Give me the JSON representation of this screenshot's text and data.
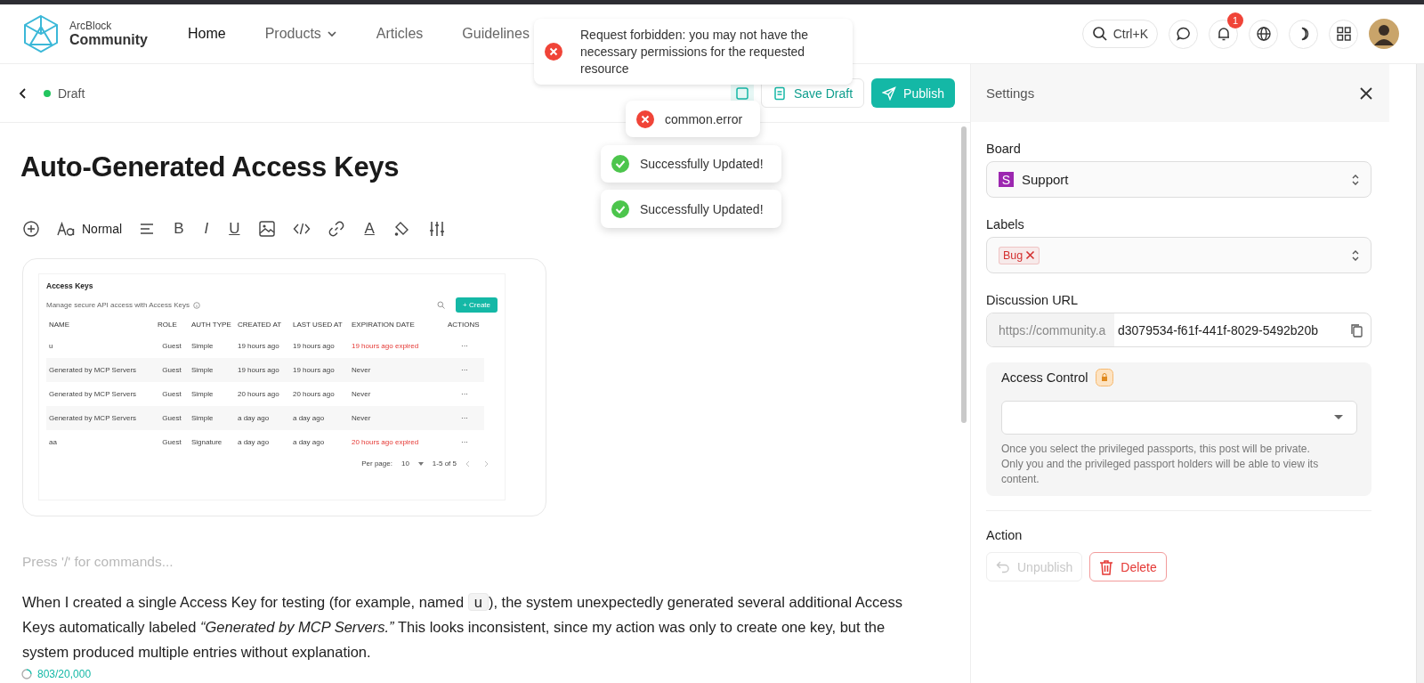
{
  "header": {
    "logo_top": "ArcBlock",
    "logo_bottom": "Community",
    "nav": [
      {
        "label": "Home",
        "selected": true,
        "dropdown": false
      },
      {
        "label": "Products",
        "selected": false,
        "dropdown": true
      },
      {
        "label": "Articles",
        "selected": false,
        "dropdown": false
      },
      {
        "label": "Guidelines",
        "selected": false,
        "dropdown": false
      }
    ],
    "search_shortcut": "Ctrl+K",
    "notification_count": "1"
  },
  "editor_bar": {
    "status": "Draft",
    "save_label": "Save Draft",
    "publish_label": "Publish"
  },
  "post": {
    "title": "Auto-Generated Access Keys",
    "toolbar": [
      {
        "kind": "insert"
      },
      {
        "kind": "heading",
        "label": "Normal"
      },
      {
        "kind": "align"
      },
      {
        "kind": "bold",
        "glyph": "B"
      },
      {
        "kind": "italic",
        "glyph": "I"
      },
      {
        "kind": "underline",
        "glyph": "U"
      },
      {
        "kind": "image"
      },
      {
        "kind": "code"
      },
      {
        "kind": "link"
      },
      {
        "kind": "text-color",
        "glyph": "A"
      },
      {
        "kind": "fill"
      },
      {
        "kind": "sliders"
      }
    ],
    "screenshot": {
      "title": "Access Keys",
      "subtitle": "Manage secure API access with Access Keys",
      "create_label": "+ Create",
      "columns": [
        "NAME",
        "ROLE",
        "AUTH TYPE",
        "CREATED AT",
        "LAST USED AT",
        "EXPIRATION DATE",
        "ACTIONS"
      ],
      "rows": [
        {
          "name": "u",
          "role": "Guest",
          "auth": "Simple",
          "created": "19 hours ago",
          "last_used": "19 hours ago",
          "expiration": "19 hours ago expired",
          "expired": true,
          "actions": "···"
        },
        {
          "name": "Generated by MCP Servers",
          "role": "Guest",
          "auth": "Simple",
          "created": "19 hours ago",
          "last_used": "19 hours ago",
          "expiration": "Never",
          "expired": false,
          "actions": "···"
        },
        {
          "name": "Generated by MCP Servers",
          "role": "Guest",
          "auth": "Simple",
          "created": "20 hours ago",
          "last_used": "20 hours ago",
          "expiration": "Never",
          "expired": false,
          "actions": "···"
        },
        {
          "name": "Generated by MCP Servers",
          "role": "Guest",
          "auth": "Simple",
          "created": "a day ago",
          "last_used": "a day ago",
          "expiration": "Never",
          "expired": false,
          "actions": "···"
        },
        {
          "name": "aa",
          "role": "Guest",
          "auth": "Signature",
          "created": "a day ago",
          "last_used": "a day ago",
          "expiration": "20 hours ago expired",
          "expired": true,
          "actions": "···"
        }
      ],
      "per_page_label": "Per page:",
      "per_page": "10",
      "range": "1-5 of 5"
    },
    "placeholder": "Press '/' for commands...",
    "paragraph": [
      {
        "kind": "text",
        "text": "When I created a single Access Key for testing (for example, named "
      },
      {
        "kind": "code",
        "text": "u"
      },
      {
        "kind": "text",
        "text": "), the system unexpectedly generated several additional Access Keys automatically labeled *“Generated by MCP Servers.”* This looks inconsistent, since my action was only to create one key, but the system produced multiple entries without explanation."
      }
    ],
    "word_count": "803/20,000"
  },
  "settings": {
    "title": "Settings",
    "board_label": "Board",
    "board_initial": "S",
    "board": "Support",
    "labels_label": "Labels",
    "labels": [
      {
        "name": "Bug",
        "color": "#d32f2f"
      }
    ],
    "url_label": "Discussion URL",
    "url_prefix": "https://community.a",
    "url_value": "d3079534-f61f-441f-8029-5492b20b",
    "access_label": "Access Control",
    "access_help": "Once you select the privileged passports, this post will be private. Only you and the privileged passport holders will be able to view its content.",
    "action_label": "Action",
    "unpublish_label": "Unpublish",
    "unpublish_disabled": true,
    "delete_label": "Delete"
  },
  "toasts": [
    {
      "kind": "error",
      "text": "Request forbidden: you may not have the necessary permissions for the requested resource"
    },
    {
      "kind": "error",
      "text": "common.error"
    },
    {
      "kind": "success",
      "text": "Successfully Updated!"
    },
    {
      "kind": "success",
      "text": "Successfully Updated!"
    }
  ]
}
